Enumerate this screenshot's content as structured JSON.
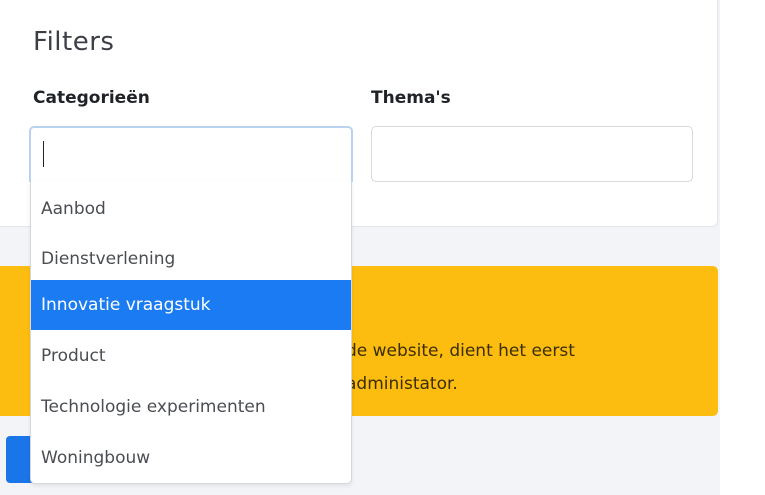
{
  "filters": {
    "title": "Filters",
    "categories_label": "Categorieën",
    "themes_label": "Thema's",
    "categories_input_value": "",
    "themes_input_value": ""
  },
  "dropdown": {
    "options": [
      {
        "label": "Aanbod",
        "active": false
      },
      {
        "label": "Dienstverlening",
        "active": false
      },
      {
        "label": "Innovatie vraagstuk",
        "active": true
      },
      {
        "label": "Product",
        "active": false
      },
      {
        "label": "Technologie experimenten",
        "active": false
      },
      {
        "label": "Woningbouw",
        "active": false
      }
    ]
  },
  "warning": {
    "line1": "de website, dient het eerst",
    "line2": "administator."
  },
  "colors": {
    "accent": "#1a7bf2",
    "warning_bg": "#fdbd10",
    "page_bg": "#f3f4f7"
  }
}
